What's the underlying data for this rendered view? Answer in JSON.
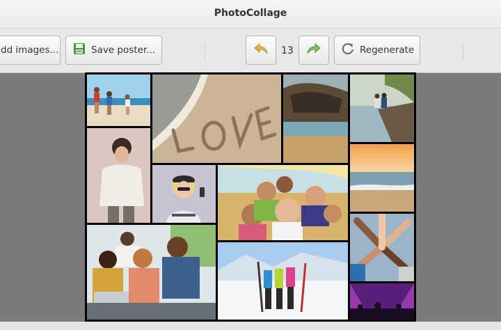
{
  "window": {
    "title": "PhotoCollage"
  },
  "toolbar": {
    "add_images_label": "dd images...",
    "save_poster_label": "Save poster...",
    "history_count": "13",
    "regenerate_label": "Regenerate"
  },
  "colors": {
    "undo_arrow": "#e0b84a",
    "redo_arrow": "#7fbf6a",
    "save_icon": "#3f9a3a"
  },
  "icons": {
    "add_images": "add-images-icon",
    "save": "save-poster-icon",
    "undo": "undo-arrow-icon",
    "redo": "redo-arrow-icon",
    "regenerate": "refresh-icon"
  }
}
